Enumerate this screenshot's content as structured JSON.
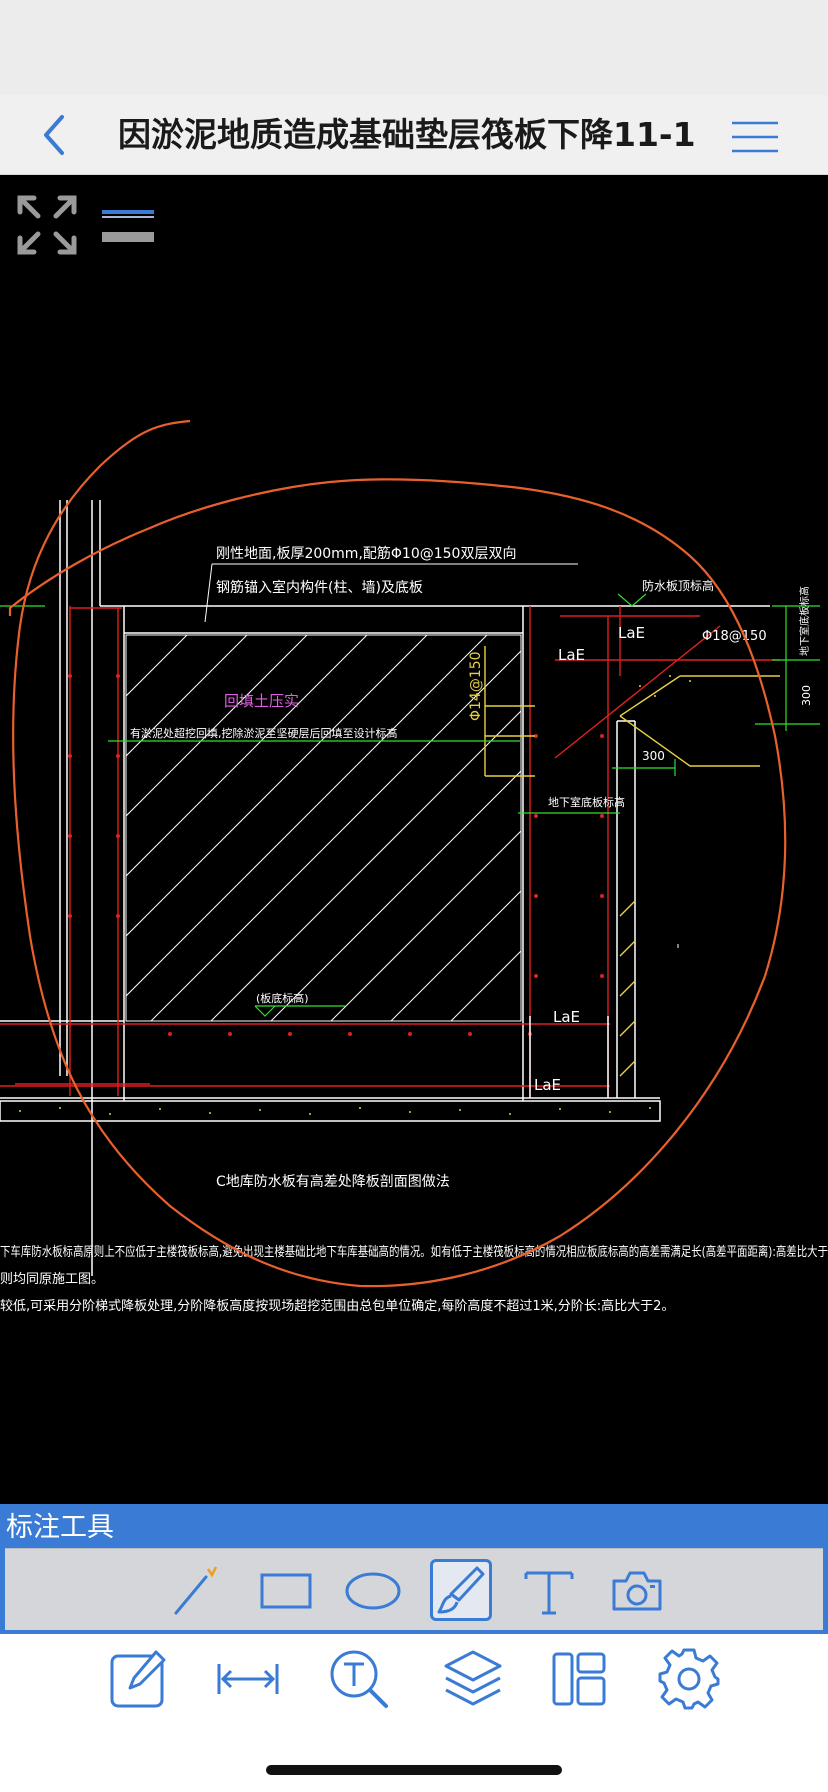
{
  "header": {
    "title": "因淤泥地质造成基础垫层筏板下降11-1"
  },
  "icons": {
    "back": "chevron-left-icon",
    "menu": "hamburger-menu-icon",
    "expand": "expand-arrows-icon",
    "layers_toggle": "layer-toggle-icon"
  },
  "colors": {
    "accent": "#3a7bd5",
    "annotation_stroke": "#e8602c",
    "cad_white": "#ffffff",
    "cad_red": "#e02020",
    "cad_yellow": "#e8d040",
    "cad_magenta": "#e060e0",
    "cad_green": "#30e030"
  },
  "drawing": {
    "labels": {
      "slab_note": "刚性地面,板厚200mm,配筋Φ10@150双层双向",
      "anchor_note": "钢筋锚入室内构件(柱、墙)及底板",
      "backfill": "回填土压实",
      "excavation_note": "有淤泥处超挖回填,挖除淤泥至坚硬层后回填至设计标高",
      "waterproof_level": "防水板顶标高",
      "rebar_main": "Φ18@150",
      "rebar_side": "Φ14@150",
      "dim_300a": "300",
      "dim_300b": "300",
      "basement_floor": "地下室底板标高",
      "slab_bottom": "(板底标高)",
      "side_tag": "地下室底板标高",
      "lae_1": "LaE",
      "lae_2": "LaE",
      "lae_3": "LaE",
      "lae_4": "LaE",
      "section_title": "C地库防水板有高差处降板剖面图做法",
      "note_line1": "下车库防水板标高原则上不应低于主楼筏板标高,避免出现主楼基础比地下车库基础高的情况。如有低于主楼筏板标高的情况相应板底标高的高差需满足长(高差平面距离):高差比大于",
      "note_line2": "则均同原施工图。",
      "note_line3": "较低,可采用分阶梯式降板处理,分阶降板高度按现场超挖范围由总包单位确定,每阶高度不超过1米,分阶长:高比大于2。"
    }
  },
  "annotation_panel": {
    "title": "标注工具",
    "tools": [
      {
        "icon": "line-pen-icon"
      },
      {
        "icon": "rectangle-icon"
      },
      {
        "icon": "ellipse-icon"
      },
      {
        "icon": "brush-icon",
        "active": true
      },
      {
        "icon": "text-icon"
      },
      {
        "icon": "camera-icon"
      }
    ]
  },
  "bottom_toolbar": {
    "buttons": [
      {
        "icon": "edit-note-icon"
      },
      {
        "icon": "measure-icon"
      },
      {
        "icon": "text-search-icon"
      },
      {
        "icon": "layers-icon"
      },
      {
        "icon": "layout-icon"
      },
      {
        "icon": "settings-gear-icon"
      }
    ]
  }
}
